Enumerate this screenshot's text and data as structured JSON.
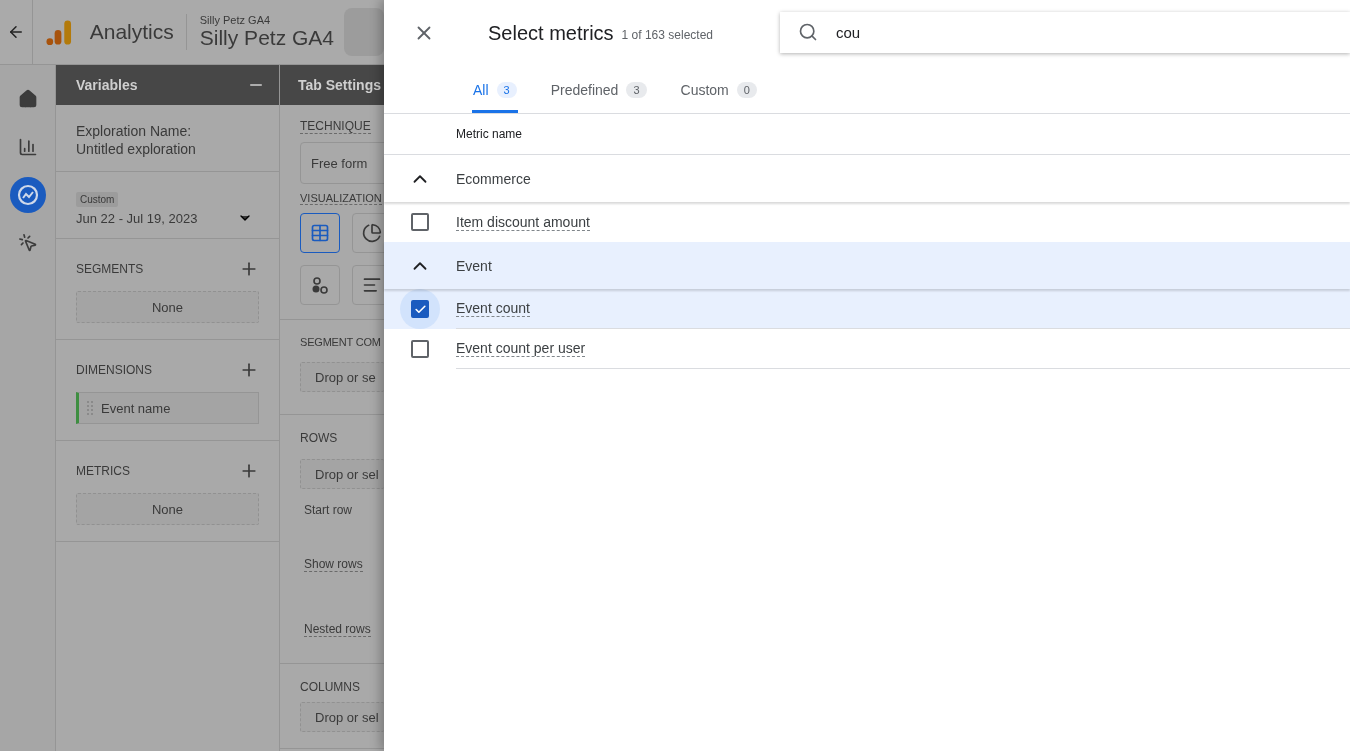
{
  "app": {
    "title": "Analytics",
    "property_subtitle": "Silly Petz GA4",
    "property": "Silly Petz GA4"
  },
  "nav": [
    {
      "kind": "home",
      "selected": false
    },
    {
      "kind": "reports",
      "selected": false
    },
    {
      "kind": "explore",
      "selected": true
    },
    {
      "kind": "advertising",
      "selected": false
    }
  ],
  "variables": {
    "title": "Variables",
    "name_label": "Exploration Name:",
    "name_value": "Untitled exploration",
    "date_badge": "Custom",
    "date_range": "Jun 22 - Jul 19, 2023",
    "sections": [
      {
        "title": "SEGMENTS",
        "empty": "None"
      },
      {
        "title": "DIMENSIONS",
        "items": [
          "Event name"
        ]
      },
      {
        "title": "METRICS",
        "empty": "None"
      }
    ]
  },
  "tab_settings": {
    "title": "Tab Settings",
    "technique_label": "TECHNIQUE",
    "technique_value": "Free form",
    "visualization_label": "VISUALIZATION",
    "visualizations": [
      {
        "kind": "table",
        "selected": true
      },
      {
        "kind": "donut",
        "selected": false
      },
      {
        "kind": "scatter",
        "selected": false
      },
      {
        "kind": "bar",
        "selected": false
      }
    ],
    "segment_label": "SEGMENT COM",
    "segment_drop": "Drop or se",
    "rows_label": "ROWS",
    "rows_drop": "Drop or sel",
    "start_row": "Start row",
    "show_rows": "Show rows",
    "nested_rows": "Nested rows",
    "columns_label": "COLUMNS",
    "columns_drop": "Drop or sel"
  },
  "dialog": {
    "title": "Select metrics",
    "count": "1 of 163 selected",
    "search_value": "cou",
    "tabs": [
      {
        "label": "All",
        "count": "3",
        "selected": true
      },
      {
        "label": "Predefined",
        "count": "3",
        "selected": false
      },
      {
        "label": "Custom",
        "count": "0",
        "selected": false
      }
    ],
    "column_header": "Metric name",
    "groups": [
      {
        "name": "Ecommerce",
        "expanded": true,
        "items": [
          {
            "name": "Item discount amount",
            "checked": false
          }
        ]
      },
      {
        "name": "Event",
        "expanded": true,
        "items": [
          {
            "name": "Event count",
            "checked": true
          },
          {
            "name": "Event count per user",
            "checked": false
          }
        ]
      }
    ]
  }
}
